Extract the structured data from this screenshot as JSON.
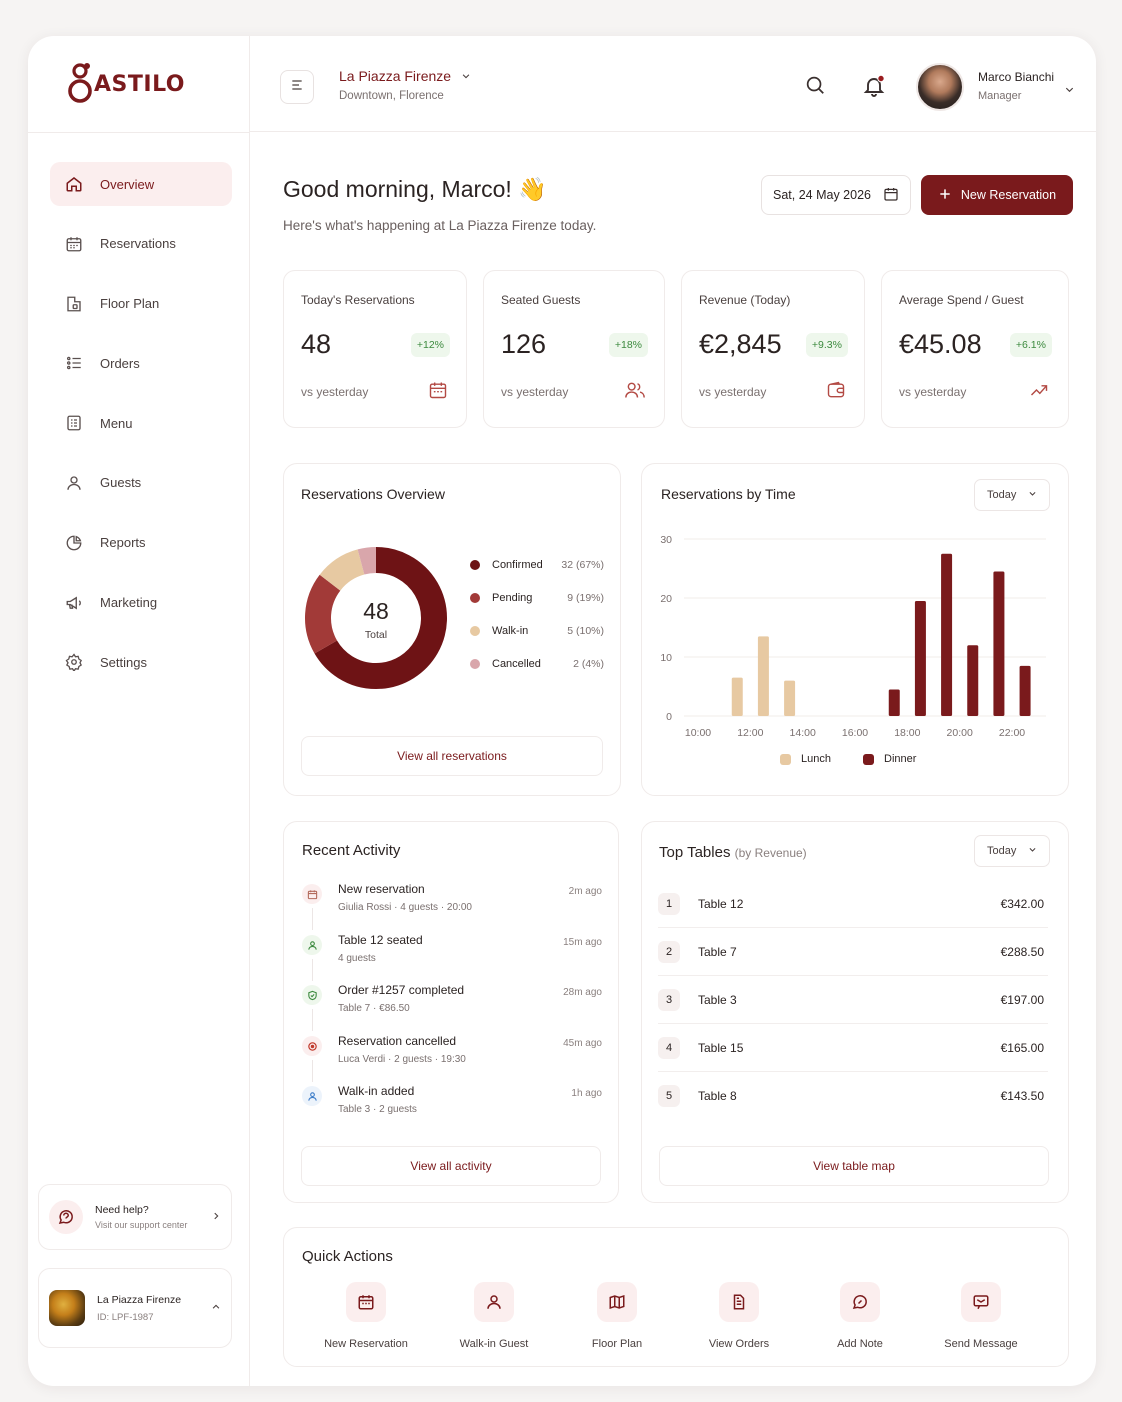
{
  "brand": {
    "logo_text": "ASTILO"
  },
  "sidebar": {
    "items": [
      {
        "label": "Overview",
        "icon": "home-icon",
        "active": true
      },
      {
        "label": "Reservations",
        "icon": "calendar-icon"
      },
      {
        "label": "Floor Plan",
        "icon": "floor-plan-icon"
      },
      {
        "label": "Orders",
        "icon": "list-icon"
      },
      {
        "label": "Menu",
        "icon": "menu-book-icon"
      },
      {
        "label": "Guests",
        "icon": "user-icon"
      },
      {
        "label": "Reports",
        "icon": "pie-chart-icon"
      },
      {
        "label": "Marketing",
        "icon": "megaphone-icon"
      },
      {
        "label": "Settings",
        "icon": "gear-icon"
      }
    ],
    "help": {
      "title": "Need help?",
      "subtitle": "Visit our support center"
    },
    "restaurant": {
      "name": "La Piazza Firenze",
      "id": "ID: LPF-1987"
    }
  },
  "topbar": {
    "venue_name": "La Piazza Firenze",
    "venue_location": "Downtown, Florence",
    "user_name": "Marco Bianchi",
    "user_role": "Manager"
  },
  "header": {
    "greeting": "Good morning, Marco! 👋",
    "subtitle": "Here's what's happening at La Piazza Firenze today.",
    "date": "Sat, 24 May 2026",
    "new_button": "New Reservation"
  },
  "stats": [
    {
      "label": "Today's Reservations",
      "value": "48",
      "change": "+12%",
      "foot": "vs yesterday",
      "icon": "calendar-icon"
    },
    {
      "label": "Seated Guests",
      "value": "126",
      "change": "+18%",
      "foot": "vs yesterday",
      "icon": "users-icon"
    },
    {
      "label": "Revenue (Today)",
      "value": "€2,845",
      "change": "+9.3%",
      "foot": "vs yesterday",
      "icon": "wallet-icon"
    },
    {
      "label": "Average Spend / Guest",
      "value": "€45.08",
      "change": "+6.1%",
      "foot": "vs yesterday",
      "icon": "trend-up-icon"
    }
  ],
  "overview": {
    "title": "Reservations Overview",
    "total_value": "48",
    "total_label": "Total",
    "link": "View all reservations",
    "legend": [
      {
        "label": "Confirmed",
        "value": "32 (67%)",
        "color": "#6e1315"
      },
      {
        "label": "Pending",
        "value": "9 (19%)",
        "color": "#a23a38"
      },
      {
        "label": "Walk-in",
        "value": "5 (10%)",
        "color": "#e7c9a2"
      },
      {
        "label": "Cancelled",
        "value": "2 (4%)",
        "color": "#d9a6ab"
      }
    ]
  },
  "by_time": {
    "title": "Reservations by Time",
    "filter": "Today",
    "legend_lunch": "Lunch",
    "legend_dinner": "Dinner"
  },
  "chart_data": {
    "type": "bar",
    "title": "Reservations by Time",
    "x": [
      "11:30",
      "12:30",
      "13:30",
      "17:30",
      "18:30",
      "19:30",
      "20:30",
      "21:30",
      "22:30"
    ],
    "series": [
      {
        "name": "Lunch",
        "color": "#e7c9a2",
        "values": [
          6.5,
          13.5,
          6,
          0,
          0,
          0,
          0,
          0,
          0
        ]
      },
      {
        "name": "Dinner",
        "color": "#7a1a1c",
        "values": [
          0,
          0,
          0,
          4.5,
          19.5,
          27.5,
          12,
          24.5,
          8.5
        ]
      }
    ],
    "x_ticks": [
      "10:00",
      "12:00",
      "14:00",
      "16:00",
      "18:00",
      "20:00",
      "22:00"
    ],
    "y_ticks": [
      0,
      10,
      20,
      30
    ],
    "ylim": [
      0,
      30
    ],
    "grid": true,
    "legend_position": "bottom"
  },
  "activity": {
    "title": "Recent Activity",
    "link": "View all activity",
    "items": [
      {
        "title": "New reservation",
        "sub": "Giulia Rossi · 4 guests · 20:00",
        "time": "2m ago",
        "icon": "calendar-icon",
        "color": "#b36b5c",
        "bg": "#fbeeee"
      },
      {
        "title": "Table 12 seated",
        "sub": "4 guests",
        "time": "15m ago",
        "icon": "user-icon",
        "color": "#3c8a3e",
        "bg": "#eef7ec"
      },
      {
        "title": "Order #1257 completed",
        "sub": "Table 7 · €86.50",
        "time": "28m ago",
        "icon": "shield-check-icon",
        "color": "#3c8a3e",
        "bg": "#eef7ec"
      },
      {
        "title": "Reservation cancelled",
        "sub": "Luca Verdi · 2 guests · 19:30",
        "time": "45m ago",
        "icon": "cancel-icon",
        "color": "#c0392b",
        "bg": "#fbeeee"
      },
      {
        "title": "Walk-in added",
        "sub": "Table 3 · 2 guests",
        "time": "1h ago",
        "icon": "user-icon",
        "color": "#3a7bc8",
        "bg": "#ecf3fb"
      }
    ]
  },
  "top_tables": {
    "title": "Top Tables",
    "title_suffix": "(by Revenue)",
    "filter": "Today",
    "link": "View table map",
    "rows": [
      {
        "rank": "1",
        "name": "Table 12",
        "value": "€342.00"
      },
      {
        "rank": "2",
        "name": "Table 7",
        "value": "€288.50"
      },
      {
        "rank": "3",
        "name": "Table 3",
        "value": "€197.00"
      },
      {
        "rank": "4",
        "name": "Table 15",
        "value": "€165.00"
      },
      {
        "rank": "5",
        "name": "Table 8",
        "value": "€143.50"
      }
    ]
  },
  "quick_actions": {
    "title": "Quick Actions",
    "items": [
      {
        "label": "New Reservation",
        "icon": "calendar-icon"
      },
      {
        "label": "Walk-in Guest",
        "icon": "user-icon"
      },
      {
        "label": "Floor Plan",
        "icon": "map-icon"
      },
      {
        "label": "View Orders",
        "icon": "document-icon"
      },
      {
        "label": "Add Note",
        "icon": "note-icon"
      },
      {
        "label": "Send Message",
        "icon": "message-icon"
      }
    ]
  },
  "colors": {
    "brand": "#7a1a1c",
    "accent_bg": "#fbeeee",
    "positive": "#3c8a3e"
  }
}
